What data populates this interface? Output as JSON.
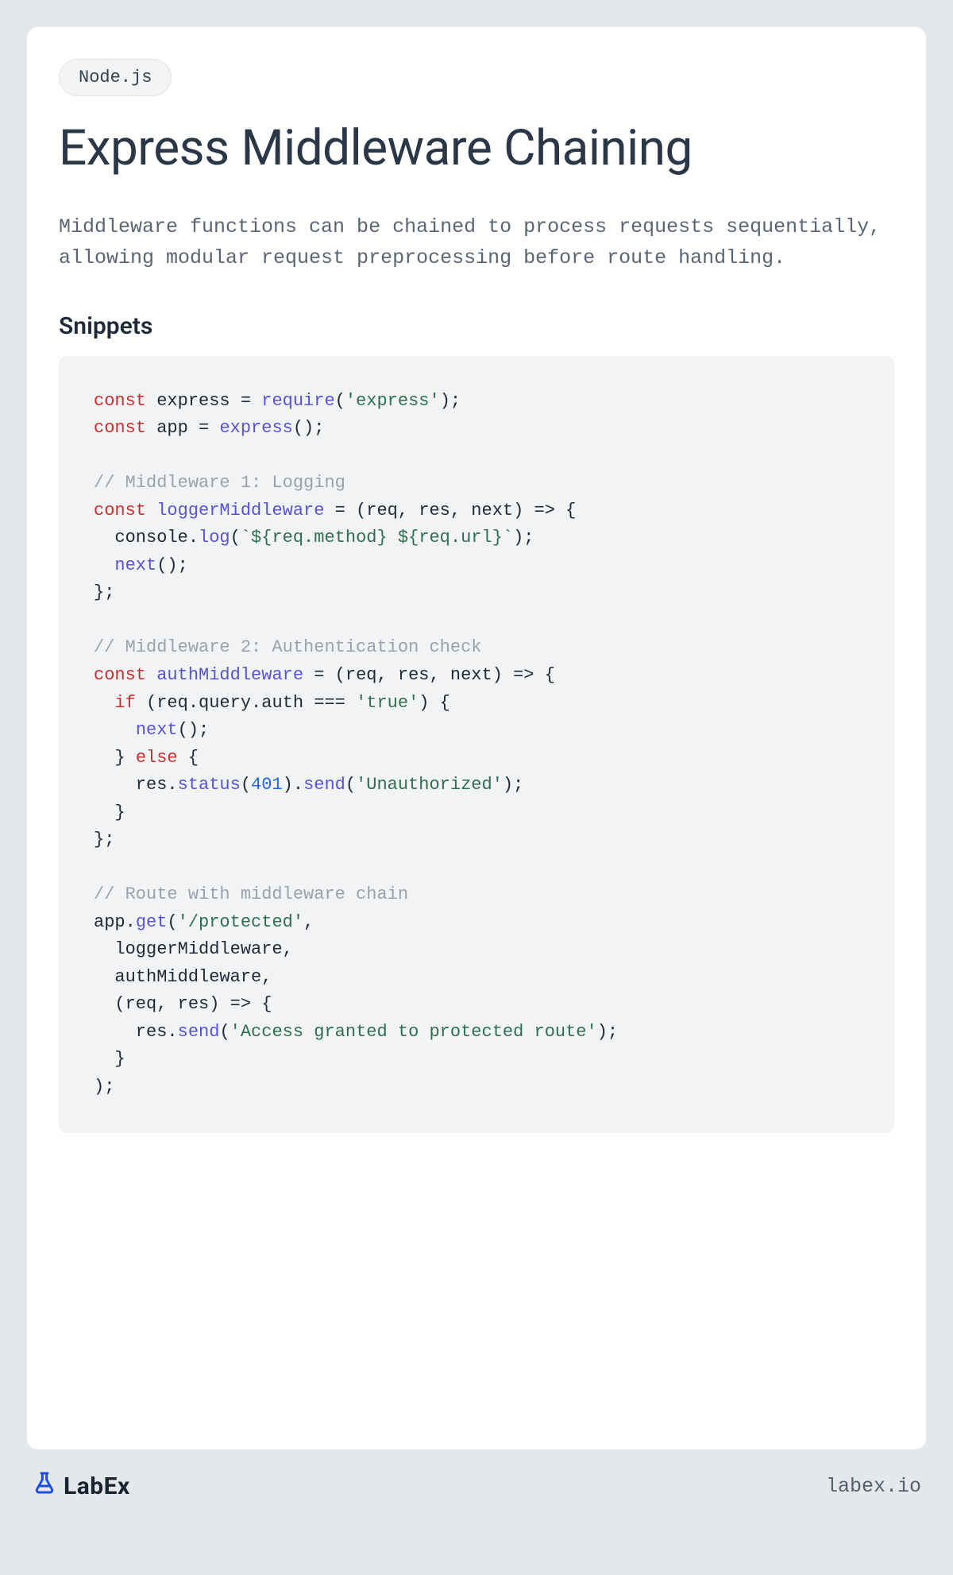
{
  "tag": "Node.js",
  "title": "Express Middleware Chaining",
  "description": "Middleware functions can be chained to process requests sequentially, allowing modular request preprocessing before route handling.",
  "section_heading": "Snippets",
  "code": {
    "tokens": [
      {
        "t": "const ",
        "c": "tok-kw"
      },
      {
        "t": "express = ",
        "c": "tok-id"
      },
      {
        "t": "require",
        "c": "tok-fn"
      },
      {
        "t": "(",
        "c": "tok-id"
      },
      {
        "t": "'express'",
        "c": "tok-str"
      },
      {
        "t": ");",
        "c": "tok-id"
      },
      {
        "t": "\n",
        "c": ""
      },
      {
        "t": "const ",
        "c": "tok-kw"
      },
      {
        "t": "app = ",
        "c": "tok-id"
      },
      {
        "t": "express",
        "c": "tok-fn"
      },
      {
        "t": "();",
        "c": "tok-id"
      },
      {
        "t": "\n",
        "c": ""
      },
      {
        "t": "\n",
        "c": ""
      },
      {
        "t": "// Middleware 1: Logging",
        "c": "tok-cm"
      },
      {
        "t": "\n",
        "c": ""
      },
      {
        "t": "const ",
        "c": "tok-kw"
      },
      {
        "t": "loggerMiddleware",
        "c": "tok-fn"
      },
      {
        "t": " = (req, res, next) => {",
        "c": "tok-id"
      },
      {
        "t": "\n",
        "c": ""
      },
      {
        "t": "  console.",
        "c": "tok-id"
      },
      {
        "t": "log",
        "c": "tok-fn"
      },
      {
        "t": "(",
        "c": "tok-id"
      },
      {
        "t": "`${req.method} ${req.url}`",
        "c": "tok-str"
      },
      {
        "t": ");",
        "c": "tok-id"
      },
      {
        "t": "\n",
        "c": ""
      },
      {
        "t": "  ",
        "c": ""
      },
      {
        "t": "next",
        "c": "tok-fn"
      },
      {
        "t": "();",
        "c": "tok-id"
      },
      {
        "t": "\n",
        "c": ""
      },
      {
        "t": "};",
        "c": "tok-id"
      },
      {
        "t": "\n",
        "c": ""
      },
      {
        "t": "\n",
        "c": ""
      },
      {
        "t": "// Middleware 2: Authentication check",
        "c": "tok-cm"
      },
      {
        "t": "\n",
        "c": ""
      },
      {
        "t": "const ",
        "c": "tok-kw"
      },
      {
        "t": "authMiddleware",
        "c": "tok-fn"
      },
      {
        "t": " = (req, res, next) => {",
        "c": "tok-id"
      },
      {
        "t": "\n",
        "c": ""
      },
      {
        "t": "  ",
        "c": ""
      },
      {
        "t": "if",
        "c": "tok-kw"
      },
      {
        "t": " (req.query.auth === ",
        "c": "tok-id"
      },
      {
        "t": "'true'",
        "c": "tok-str"
      },
      {
        "t": ") {",
        "c": "tok-id"
      },
      {
        "t": "\n",
        "c": ""
      },
      {
        "t": "    ",
        "c": ""
      },
      {
        "t": "next",
        "c": "tok-fn"
      },
      {
        "t": "();",
        "c": "tok-id"
      },
      {
        "t": "\n",
        "c": ""
      },
      {
        "t": "  } ",
        "c": "tok-id"
      },
      {
        "t": "else",
        "c": "tok-kw"
      },
      {
        "t": " {",
        "c": "tok-id"
      },
      {
        "t": "\n",
        "c": ""
      },
      {
        "t": "    res.",
        "c": "tok-id"
      },
      {
        "t": "status",
        "c": "tok-fn"
      },
      {
        "t": "(",
        "c": "tok-id"
      },
      {
        "t": "401",
        "c": "tok-num"
      },
      {
        "t": ").",
        "c": "tok-id"
      },
      {
        "t": "send",
        "c": "tok-fn"
      },
      {
        "t": "(",
        "c": "tok-id"
      },
      {
        "t": "'Unauthorized'",
        "c": "tok-str"
      },
      {
        "t": ");",
        "c": "tok-id"
      },
      {
        "t": "\n",
        "c": ""
      },
      {
        "t": "  }",
        "c": "tok-id"
      },
      {
        "t": "\n",
        "c": ""
      },
      {
        "t": "};",
        "c": "tok-id"
      },
      {
        "t": "\n",
        "c": ""
      },
      {
        "t": "\n",
        "c": ""
      },
      {
        "t": "// Route with middleware chain",
        "c": "tok-cm"
      },
      {
        "t": "\n",
        "c": ""
      },
      {
        "t": "app.",
        "c": "tok-id"
      },
      {
        "t": "get",
        "c": "tok-fn"
      },
      {
        "t": "(",
        "c": "tok-id"
      },
      {
        "t": "'/protected'",
        "c": "tok-str"
      },
      {
        "t": ", ",
        "c": "tok-id"
      },
      {
        "t": "\n",
        "c": ""
      },
      {
        "t": "  loggerMiddleware,",
        "c": "tok-id"
      },
      {
        "t": "\n",
        "c": ""
      },
      {
        "t": "  authMiddleware,",
        "c": "tok-id"
      },
      {
        "t": "\n",
        "c": ""
      },
      {
        "t": "  (req, res) => {",
        "c": "tok-id"
      },
      {
        "t": "\n",
        "c": ""
      },
      {
        "t": "    res.",
        "c": "tok-id"
      },
      {
        "t": "send",
        "c": "tok-fn"
      },
      {
        "t": "(",
        "c": "tok-id"
      },
      {
        "t": "'Access granted to protected route'",
        "c": "tok-str"
      },
      {
        "t": ");",
        "c": "tok-id"
      },
      {
        "t": "\n",
        "c": ""
      },
      {
        "t": "  }",
        "c": "tok-id"
      },
      {
        "t": "\n",
        "c": ""
      },
      {
        "t": ");",
        "c": "tok-id"
      }
    ]
  },
  "footer": {
    "brand": "LabEx",
    "site": "labex.io"
  }
}
